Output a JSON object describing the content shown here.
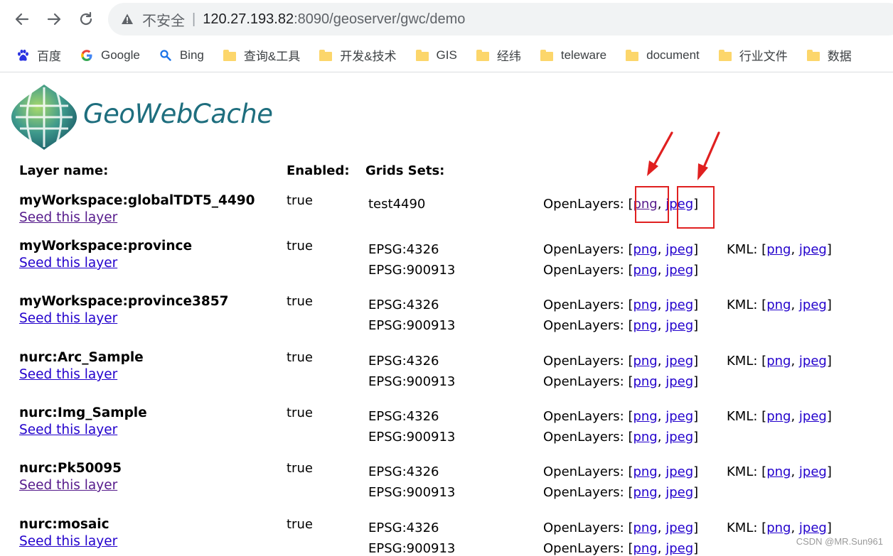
{
  "browser": {
    "security_label": "不安全",
    "separator": "|",
    "url_host": "120.27.193.82",
    "url_port": ":8090",
    "url_path": "/geoserver/gwc/demo"
  },
  "bookmarks": [
    {
      "label": "百度",
      "icon": "baidu-paw-icon"
    },
    {
      "label": "Google",
      "icon": "google-g-icon"
    },
    {
      "label": "Bing",
      "icon": "search-icon"
    },
    {
      "label": "查询&工具",
      "icon": "folder-icon"
    },
    {
      "label": "开发&技术",
      "icon": "folder-icon"
    },
    {
      "label": "GIS",
      "icon": "folder-icon"
    },
    {
      "label": "经纬",
      "icon": "folder-icon"
    },
    {
      "label": "teleware",
      "icon": "folder-icon"
    },
    {
      "label": "document",
      "icon": "folder-icon"
    },
    {
      "label": "行业文件",
      "icon": "folder-icon"
    },
    {
      "label": "数据",
      "icon": "folder-icon"
    }
  ],
  "logo": {
    "text": "GeoWebCache"
  },
  "headers": {
    "layer_name": "Layer name:",
    "enabled": "Enabled:",
    "grid_sets": "Grids Sets:"
  },
  "labels": {
    "seed": "Seed this layer",
    "openlayers": "OpenLayers:",
    "kml": "KML:",
    "png": "png",
    "jpeg": "jpeg"
  },
  "layers": [
    {
      "name": "myWorkspace:globalTDT5_4490",
      "enabled": "true",
      "gridsets": [
        "test4490"
      ],
      "kml": false
    },
    {
      "name": "myWorkspace:province",
      "enabled": "true",
      "gridsets": [
        "EPSG:4326",
        "EPSG:900913"
      ],
      "kml": true
    },
    {
      "name": "myWorkspace:province3857",
      "enabled": "true",
      "gridsets": [
        "EPSG:4326",
        "EPSG:900913"
      ],
      "kml": true
    },
    {
      "name": "nurc:Arc_Sample",
      "enabled": "true",
      "gridsets": [
        "EPSG:4326",
        "EPSG:900913"
      ],
      "kml": true
    },
    {
      "name": "nurc:Img_Sample",
      "enabled": "true",
      "gridsets": [
        "EPSG:4326",
        "EPSG:900913"
      ],
      "kml": true
    },
    {
      "name": "nurc:Pk50095",
      "enabled": "true",
      "gridsets": [
        "EPSG:4326",
        "EPSG:900913"
      ],
      "kml": true
    },
    {
      "name": "nurc:mosaic",
      "enabled": "true",
      "gridsets": [
        "EPSG:4326",
        "EPSG:900913"
      ],
      "kml": true
    }
  ],
  "watermark": "CSDN @MR.Sun961",
  "colors": {
    "link": "#2200cc",
    "visited": "#551a8b",
    "annotation": "#e02020",
    "logo_text": "#1e6e7e"
  }
}
